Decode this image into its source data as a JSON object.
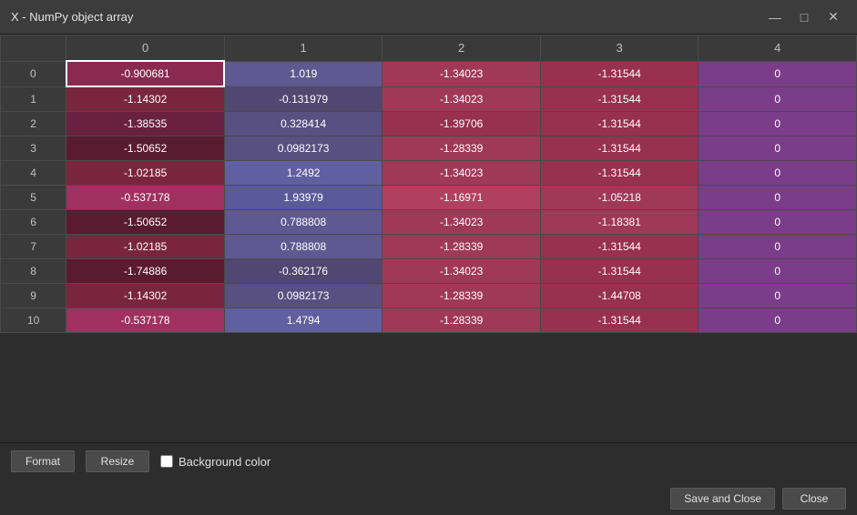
{
  "window": {
    "title": "X - NumPy object array",
    "min_btn": "—",
    "max_btn": "□",
    "close_btn": "✕"
  },
  "table": {
    "columns": [
      "",
      "0",
      "1",
      "2",
      "3",
      "4"
    ],
    "rows": [
      {
        "index": "0",
        "col0": "-0.900681",
        "col1": "1.019",
        "col2": "-1.34023",
        "col3": "-1.31544",
        "col4": "0"
      },
      {
        "index": "1",
        "col0": "-1.14302",
        "col1": "-0.131979",
        "col2": "-1.34023",
        "col3": "-1.31544",
        "col4": "0"
      },
      {
        "index": "2",
        "col0": "-1.38535",
        "col1": "0.328414",
        "col2": "-1.39706",
        "col3": "-1.31544",
        "col4": "0"
      },
      {
        "index": "3",
        "col0": "-1.50652",
        "col1": "0.0982173",
        "col2": "-1.28339",
        "col3": "-1.31544",
        "col4": "0"
      },
      {
        "index": "4",
        "col0": "-1.02185",
        "col1": "1.2492",
        "col2": "-1.34023",
        "col3": "-1.31544",
        "col4": "0"
      },
      {
        "index": "5",
        "col0": "-0.537178",
        "col1": "1.93979",
        "col2": "-1.16971",
        "col3": "-1.05218",
        "col4": "0"
      },
      {
        "index": "6",
        "col0": "-1.50652",
        "col1": "0.788808",
        "col2": "-1.34023",
        "col3": "-1.18381",
        "col4": "0"
      },
      {
        "index": "7",
        "col0": "-1.02185",
        "col1": "0.788808",
        "col2": "-1.28339",
        "col3": "-1.31544",
        "col4": "0"
      },
      {
        "index": "8",
        "col0": "-1.74886",
        "col1": "-0.362176",
        "col2": "-1.34023",
        "col3": "-1.31544",
        "col4": "0"
      },
      {
        "index": "9",
        "col0": "-1.14302",
        "col1": "0.0982173",
        "col2": "-1.28339",
        "col3": "-1.44708",
        "col4": "0"
      },
      {
        "index": "10",
        "col0": "-0.537178",
        "col1": "1.4794",
        "col2": "-1.28339",
        "col3": "-1.31544",
        "col4": "0"
      }
    ]
  },
  "footer": {
    "format_btn": "Format",
    "resize_btn": "Resize",
    "bg_color_label": "Background color",
    "save_close_btn": "Save and Close",
    "close_btn": "Close"
  }
}
